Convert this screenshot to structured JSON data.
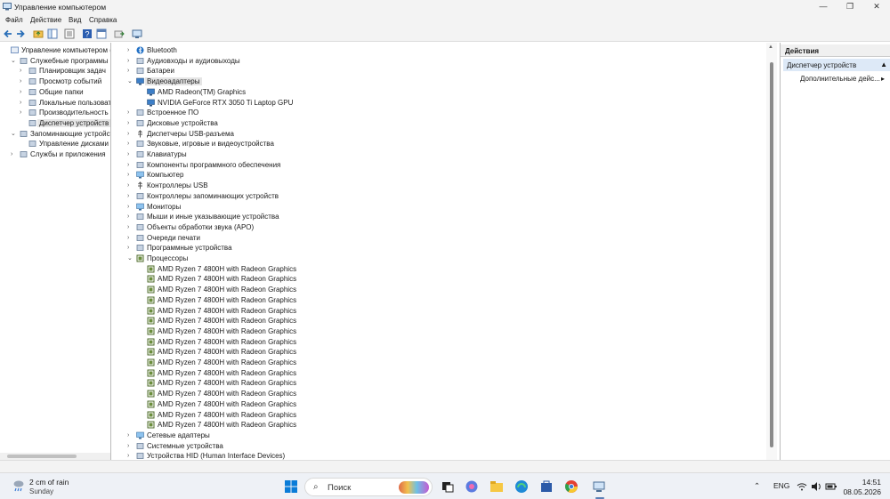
{
  "window": {
    "title": "Управление компьютером",
    "controls": {
      "minimize": "—",
      "maximize": "❐",
      "close": "✕"
    }
  },
  "menu": [
    "Файл",
    "Действие",
    "Вид",
    "Справка"
  ],
  "toolbar": [
    "back-icon",
    "forward-icon",
    "up-folder-icon",
    "show-hide-tree-icon",
    "properties-icon",
    "help-icon",
    "console-icon",
    "export-icon",
    "monitor-icon"
  ],
  "left_tree": [
    {
      "label": "Управление компьютером (лс",
      "expander": "",
      "icon": "computer-management-icon"
    },
    {
      "label": "Служебные программы",
      "expander": "⌄",
      "icon": "tools-icon"
    },
    {
      "label": "Планировщик задач",
      "expander": "›",
      "icon": "clock-icon"
    },
    {
      "label": "Просмотр событий",
      "expander": "›",
      "icon": "event-viewer-icon"
    },
    {
      "label": "Общие папки",
      "expander": "›",
      "icon": "shared-folder-icon"
    },
    {
      "label": "Локальные пользовате",
      "expander": "›",
      "icon": "users-icon"
    },
    {
      "label": "Производительность",
      "expander": "›",
      "icon": "performance-icon"
    },
    {
      "label": "Диспетчер устройств",
      "expander": "",
      "icon": "device-manager-icon"
    },
    {
      "label": "Запоминающие устройства",
      "expander": "⌄",
      "icon": "storage-icon"
    },
    {
      "label": "Управление дисками",
      "expander": "",
      "icon": "disk-management-icon"
    },
    {
      "label": "Службы и приложения",
      "expander": "›",
      "icon": "services-icon"
    }
  ],
  "device_tree": {
    "categories_top": [
      {
        "label": "Bluetooth",
        "icon": "bluetooth-icon"
      },
      {
        "label": "Аудиовходы и аудиовыходы",
        "icon": "audio-icon"
      },
      {
        "label": "Батареи",
        "icon": "battery-icon"
      }
    ],
    "display_adapters": {
      "label": "Видеоадаптеры",
      "children": [
        "AMD Radeon(TM) Graphics",
        "NVIDIA GeForce RTX 3050 Ti Laptop GPU"
      ]
    },
    "categories_mid": [
      {
        "label": "Встроенное ПО",
        "icon": "firmware-icon"
      },
      {
        "label": "Дисковые устройства",
        "icon": "disk-drive-icon"
      },
      {
        "label": "Диспетчеры USB-разъема",
        "icon": "usb-connector-icon"
      },
      {
        "label": "Звуковые, игровые и видеоустройства",
        "icon": "sound-icon"
      },
      {
        "label": "Клавиатуры",
        "icon": "keyboard-icon"
      },
      {
        "label": "Компоненты программного обеспечения",
        "icon": "software-component-icon"
      },
      {
        "label": "Компьютер",
        "icon": "computer-icon"
      },
      {
        "label": "Контроллеры USB",
        "icon": "usb-icon"
      },
      {
        "label": "Контроллеры запоминающих устройств",
        "icon": "storage-controller-icon"
      },
      {
        "label": "Мониторы",
        "icon": "monitor-icon"
      },
      {
        "label": "Мыши и иные указывающие устройства",
        "icon": "mouse-icon"
      },
      {
        "label": "Объекты обработки звука (APO)",
        "icon": "apo-icon"
      },
      {
        "label": "Очереди печати",
        "icon": "printer-icon"
      },
      {
        "label": "Программные устройства",
        "icon": "software-device-icon"
      }
    ],
    "processors": {
      "label": "Процессоры",
      "children": [
        "AMD Ryzen 7 4800H with Radeon Graphics",
        "AMD Ryzen 7 4800H with Radeon Graphics",
        "AMD Ryzen 7 4800H with Radeon Graphics",
        "AMD Ryzen 7 4800H with Radeon Graphics",
        "AMD Ryzen 7 4800H with Radeon Graphics",
        "AMD Ryzen 7 4800H with Radeon Graphics",
        "AMD Ryzen 7 4800H with Radeon Graphics",
        "AMD Ryzen 7 4800H with Radeon Graphics",
        "AMD Ryzen 7 4800H with Radeon Graphics",
        "AMD Ryzen 7 4800H with Radeon Graphics",
        "AMD Ryzen 7 4800H with Radeon Graphics",
        "AMD Ryzen 7 4800H with Radeon Graphics",
        "AMD Ryzen 7 4800H with Radeon Graphics",
        "AMD Ryzen 7 4800H with Radeon Graphics",
        "AMD Ryzen 7 4800H with Radeon Graphics",
        "AMD Ryzen 7 4800H with Radeon Graphics"
      ]
    },
    "categories_bottom": [
      {
        "label": "Сетевые адаптеры",
        "icon": "network-icon"
      },
      {
        "label": "Системные устройства",
        "icon": "system-device-icon"
      },
      {
        "label": "Устройства HID (Human Interface Devices)",
        "icon": "hid-icon"
      }
    ]
  },
  "actions": {
    "header": "Действия",
    "section": "Диспетчер устройств",
    "item": "Дополнительные дейс...",
    "item_arrow": "▸"
  },
  "taskbar": {
    "weather_temp": "2 cm of rain",
    "weather_day": "Sunday",
    "search_placeholder": "Поиск",
    "lang": "ENG",
    "time": "14:51",
    "date": "08.05.2026"
  },
  "colors": {
    "accent": "#0067c0",
    "selection": "#dde9f7",
    "chip": "#6b8e3d"
  }
}
